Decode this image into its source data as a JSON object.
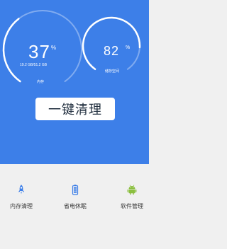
{
  "memory": {
    "value": "37",
    "unit": "%",
    "detail": "19.2 GB/51.2 GB",
    "label": "内存",
    "progress": 0.37
  },
  "storage": {
    "value": "82",
    "unit": "%",
    "label": "储存空间",
    "progress": 0.82
  },
  "actions": {
    "clean_label": "一键清理"
  },
  "tools": [
    {
      "label": "内存清理",
      "icon": "rocket-icon"
    },
    {
      "label": "省电休眠",
      "icon": "battery-icon"
    },
    {
      "label": "软件管理",
      "icon": "android-icon"
    }
  ],
  "colors": {
    "panel": "#3d7fe8",
    "accent_icon": "#3d7fe8",
    "android": "#8bbf3f"
  }
}
